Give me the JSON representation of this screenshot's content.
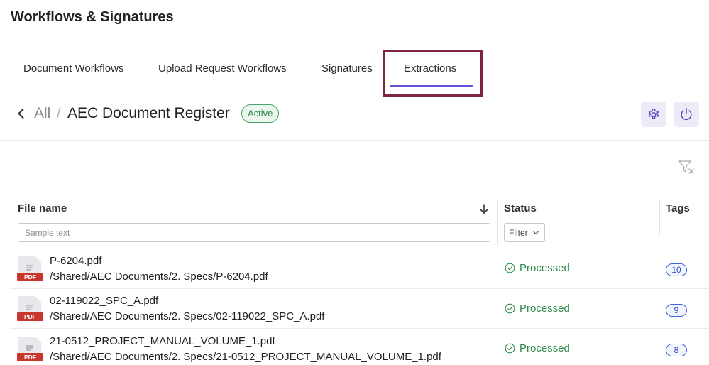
{
  "page": {
    "title": "Workflows & Signatures"
  },
  "tabs": [
    {
      "label": "Document Workflows"
    },
    {
      "label": "Upload Request Workflows"
    },
    {
      "label": "Signatures"
    },
    {
      "label": "Extractions",
      "active": true
    }
  ],
  "breadcrumb": {
    "root": "All",
    "separator": "/",
    "current": "AEC Document Register",
    "status": "Active"
  },
  "table": {
    "columns": {
      "file_name": "File name",
      "status": "Status",
      "tags": "Tags"
    },
    "search": {
      "placeholder": "Sample text"
    },
    "status_filter": {
      "label": "Filter"
    },
    "rows": [
      {
        "name": "P-6204.pdf",
        "path": "/Shared/AEC Documents/2. Specs/P-6204.pdf",
        "status": "Processed",
        "tags": "10",
        "file_type": "PDF"
      },
      {
        "name": "02-119022_SPC_A.pdf",
        "path": "/Shared/AEC Documents/2. Specs/02-119022_SPC_A.pdf",
        "status": "Processed",
        "tags": "9",
        "file_type": "PDF"
      },
      {
        "name": "21-0512_PROJECT_MANUAL_VOLUME_1.pdf",
        "path": "/Shared/AEC Documents/2. Specs/21-0512_PROJECT_MANUAL_VOLUME_1.pdf",
        "status": "Processed",
        "tags": "8",
        "file_type": "PDF"
      }
    ]
  },
  "colors": {
    "accent": "#6a4fd6",
    "highlight_box": "#7d2346",
    "success": "#2f8a4c",
    "tag": "#3f63d8",
    "pdf_red": "#c8372d"
  },
  "icons": [
    "back-chevron-icon",
    "settings-gear-icon",
    "power-icon",
    "filter-clear-icon",
    "sort-down-arrow-icon",
    "pdf-file-icon",
    "check-circle-icon",
    "chevron-down-icon"
  ]
}
